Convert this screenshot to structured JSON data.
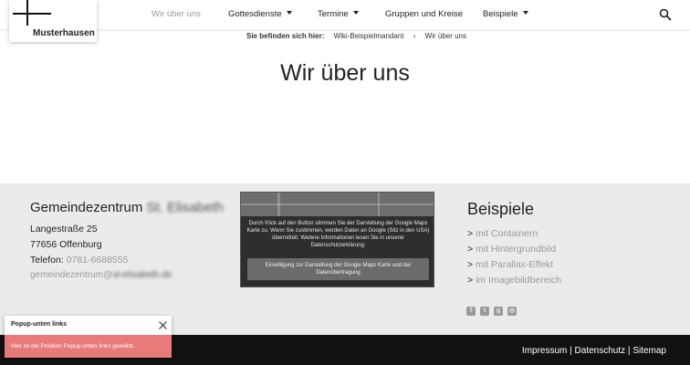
{
  "logo": {
    "name": "Musterhausen",
    "icon": "cross-icon"
  },
  "nav": {
    "items": [
      {
        "label": "Wir über uns",
        "active": true,
        "dropdown": false
      },
      {
        "label": "Gottesdienste",
        "active": false,
        "dropdown": true
      },
      {
        "label": "Termine",
        "active": false,
        "dropdown": true
      },
      {
        "label": "Gruppen und Kreise",
        "active": false,
        "dropdown": false
      },
      {
        "label": "Beispiele",
        "active": false,
        "dropdown": true
      }
    ],
    "search_icon": "search-icon"
  },
  "breadcrumb": {
    "label": "Sie befinden sich hier:",
    "items": [
      "Wiki-Beispielmandant",
      "Wir über uns"
    ]
  },
  "page": {
    "title": "Wir über uns"
  },
  "contact": {
    "name": "Gemeindezentrum",
    "name_blurred": "St. Elisabeth",
    "street": "Langestraße 25",
    "city": "77656 Offenburg",
    "phone_label": "Telefon:",
    "phone": "0781-6688555",
    "email": "gemeindezentrum@",
    "email_blurred": "st-elisabeth.de"
  },
  "map": {
    "notice": "Durch Klick auf den Button stimmen Sie der Darstellung der Google Maps Karte zu. Wenn Sie zustimmen, werden Daten an Google (Sitz in den USA) übermittelt. Weitere Informationen lesen Sie in unserer Datenschutzerklärung.",
    "button": "Einwilligung zur Darstellung der Google Maps Karte und der Datenübertragung"
  },
  "examples": {
    "title": "Beispiele",
    "links": [
      "mit Containern",
      "mit Hintergrundbild",
      "mit Parallax-Effekt",
      "im Imagebildbereich"
    ],
    "prefix": ">",
    "social_icons": [
      "facebook-icon",
      "twitter-icon",
      "googleplus-icon",
      "instagram-icon"
    ]
  },
  "footer": {
    "links": [
      "Impressum",
      "Datenschutz",
      "Sitemap"
    ],
    "separator": "|"
  },
  "popup": {
    "title": "Popup-unten links",
    "text": "Hier ist die Position Popup-unten links gewählt.",
    "close_icon": "close-icon"
  },
  "colors": {
    "accent_gray": "#9a9a9a",
    "footer_bg": "#ebebeb",
    "bottom_bar": "#111111",
    "popup_body": "#e87a7a"
  }
}
